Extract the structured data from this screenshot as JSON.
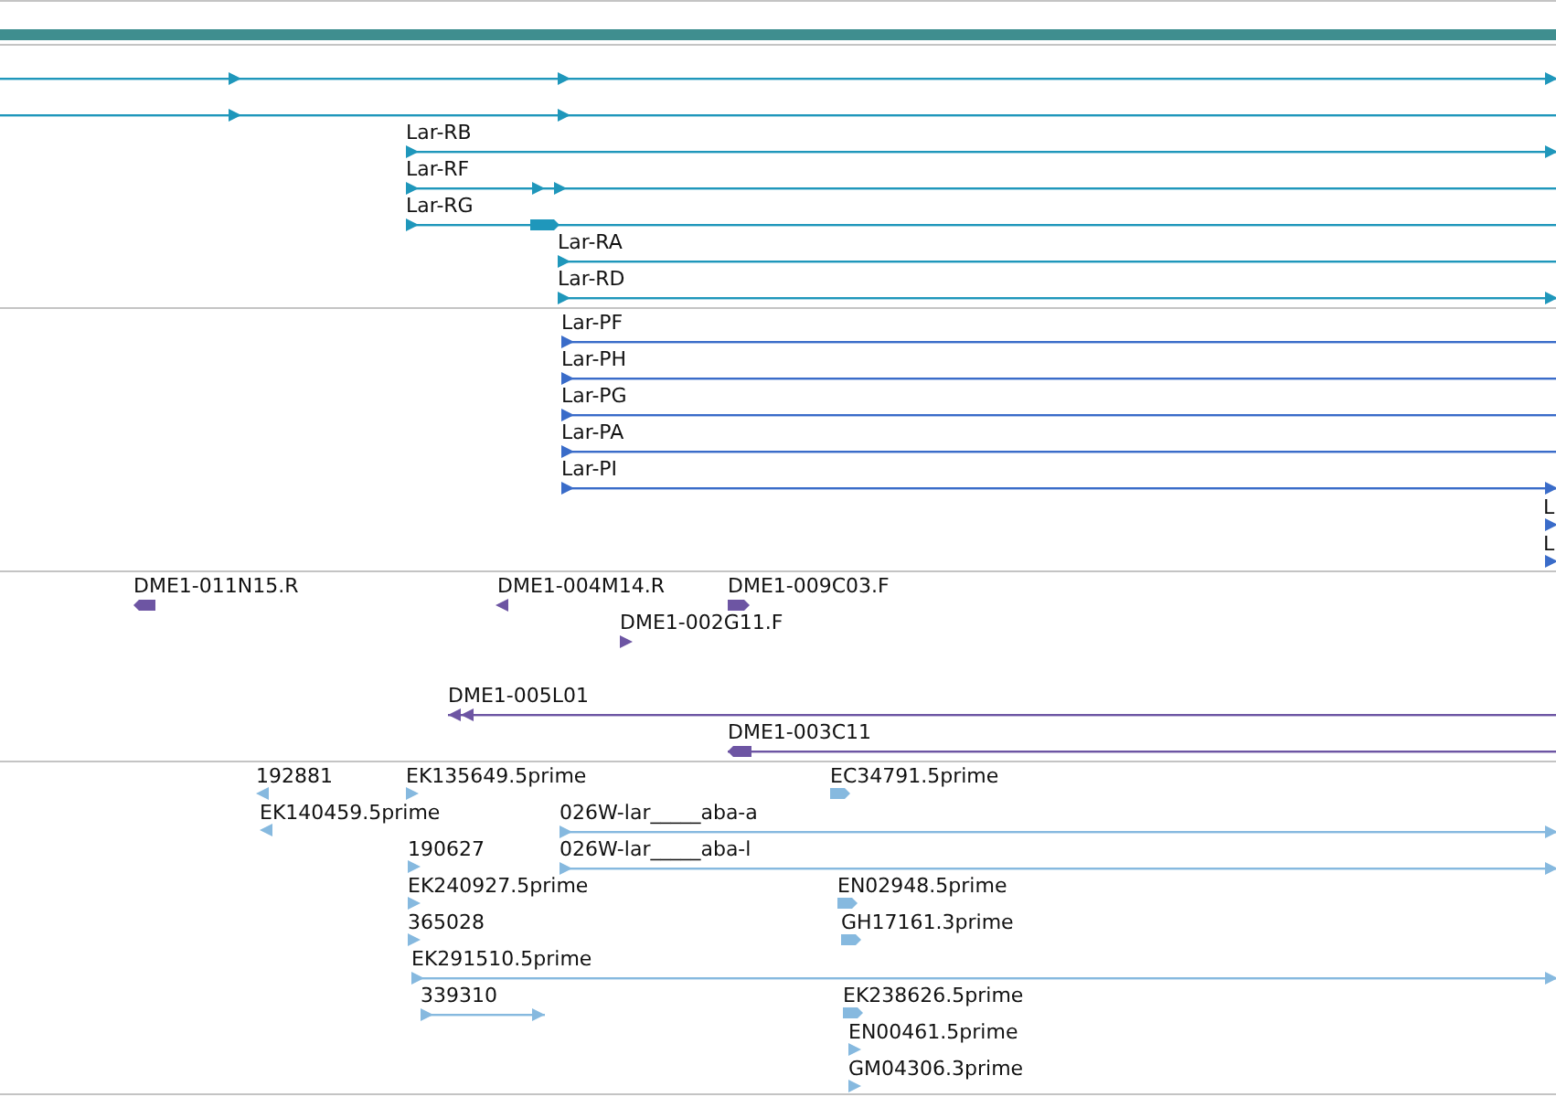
{
  "tracks": [
    {
      "kind": "gene",
      "features": [
        {
          "reverse": false
        },
        {
          "reverse": false
        },
        {
          "label": "Lar-RB",
          "reverse": false
        },
        {
          "label": "Lar-RF",
          "reverse": false
        },
        {
          "label": "Lar-RG",
          "reverse": false
        },
        {
          "label": "Lar-RA",
          "reverse": false
        },
        {
          "label": "Lar-RD",
          "reverse": false
        }
      ]
    },
    {
      "kind": "protein",
      "features": [
        {
          "label": "Lar-PF",
          "reverse": false
        },
        {
          "label": "Lar-PH",
          "reverse": false
        },
        {
          "label": "Lar-PG",
          "reverse": false
        },
        {
          "label": "Lar-PA",
          "reverse": false
        },
        {
          "label": "Lar-PI",
          "reverse": false
        },
        {
          "label": "L",
          "reverse": false
        },
        {
          "label": "L",
          "reverse": false
        }
      ]
    },
    {
      "kind": "clone",
      "features": [
        {
          "label": "DME1-011N15.R",
          "reverse": true
        },
        {
          "label": "DME1-004M14.R",
          "reverse": true
        },
        {
          "label": "DME1-009C03.F",
          "reverse": false
        },
        {
          "label": "DME1-002G11.F",
          "reverse": false
        },
        {
          "label": "DME1-005L01",
          "reverse": true
        },
        {
          "label": "DME1-003C11",
          "reverse": true
        }
      ]
    },
    {
      "kind": "est",
      "features": [
        {
          "label": "192881",
          "reverse": true
        },
        {
          "label": "EK135649.5prime",
          "reverse": false
        },
        {
          "label": "EC34791.5prime",
          "reverse": false
        },
        {
          "label": "EK140459.5prime",
          "reverse": true
        },
        {
          "label": "026W-lar_____aba-a",
          "reverse": false
        },
        {
          "label": "190627",
          "reverse": false
        },
        {
          "label": "026W-lar_____aba-l",
          "reverse": false
        },
        {
          "label": "EK240927.5prime",
          "reverse": false
        },
        {
          "label": "EN02948.5prime",
          "reverse": false
        },
        {
          "label": "365028",
          "reverse": false
        },
        {
          "label": "GH17161.3prime",
          "reverse": false
        },
        {
          "label": "EK291510.5prime",
          "reverse": false
        },
        {
          "label": "339310",
          "reverse": false
        },
        {
          "label": "EK238626.5prime",
          "reverse": false
        },
        {
          "label": "EN00461.5prime",
          "reverse": false
        },
        {
          "label": "GM04306.3prime",
          "reverse": false
        }
      ]
    }
  ]
}
